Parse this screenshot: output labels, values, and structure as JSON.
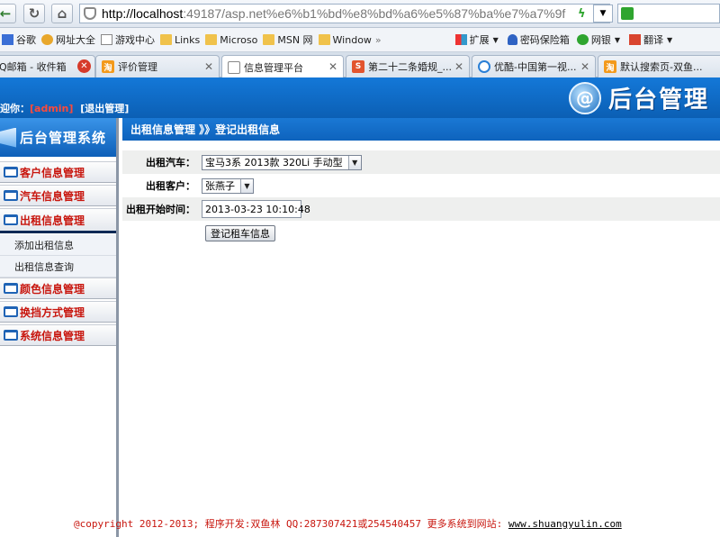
{
  "browser": {
    "url_host": "http://localhost",
    "url_rest": ":49187/asp.net%e6%b1%bd%e8%bd%a6%e5%87%ba%e7%a7%9f",
    "bookmarks": [
      "谷歌",
      "网址大全",
      "游戏中心",
      "Links",
      "Microso",
      "MSN 网",
      "Window",
      "扩展",
      "密码保险箱",
      "网银",
      "翻译"
    ],
    "tabs": [
      {
        "label": "Q邮箱 - 收件箱",
        "active": false
      },
      {
        "label": "评价管理",
        "active": false
      },
      {
        "label": "信息管理平台",
        "active": true
      },
      {
        "label": "第二十二条婚规_...",
        "active": false
      },
      {
        "label": "优酷-中国第一视...",
        "active": false
      },
      {
        "label": "默认搜索页-双鱼...",
        "active": false
      }
    ]
  },
  "header": {
    "welcome_prefix": "迎你：",
    "admin": "[admin]",
    "logout": "[退出管理]",
    "logo_text": "后台管理"
  },
  "sidebar": {
    "title": "后台管理系统",
    "menus": [
      {
        "label": "客户信息管理"
      },
      {
        "label": "汽车信息管理"
      },
      {
        "label": "出租信息管理",
        "open": true,
        "subs": [
          "添加出租信息",
          "出租信息查询"
        ]
      },
      {
        "label": "颜色信息管理"
      },
      {
        "label": "换挡方式管理"
      },
      {
        "label": "系统信息管理"
      }
    ]
  },
  "main": {
    "breadcrumb": "出租信息管理 》》登记出租信息",
    "form": {
      "car_label": "出租汽车：",
      "car_value": "宝马3系 2013款 320Li 手动型",
      "customer_label": "出租客户：",
      "customer_value": "张燕子",
      "start_label": "出租开始时间：",
      "start_value": "2013-03-23 10:10:48",
      "submit_label": "登记租车信息"
    }
  },
  "footer": {
    "text": "@copyright 2012-2013; 程序开发:双鱼林  QQ:287307421或254540457  更多系统到网站: ",
    "link": "www.shuangyulin.com"
  },
  "colors": {
    "header_blue": "#0e63bd",
    "menu_red": "#c8160e"
  }
}
